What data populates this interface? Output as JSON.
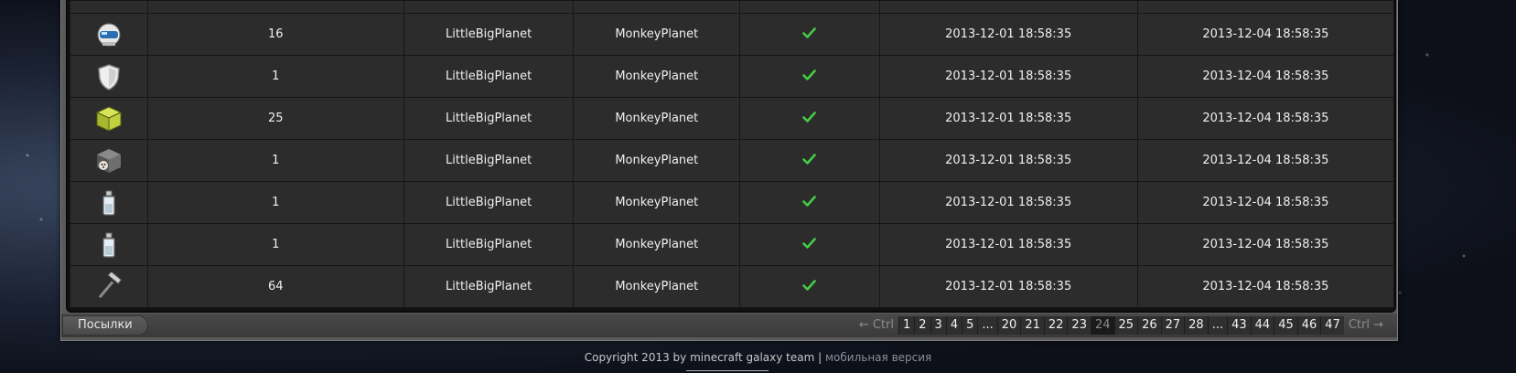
{
  "table": {
    "rows": [
      {
        "icon": "robot-helmet-icon",
        "count": "16",
        "server": "LittleBigPlanet",
        "owner": "MonkeyPlanet",
        "status": "check-icon",
        "created": "2013-12-01 18:58:35",
        "expires": "2013-12-04 18:58:35"
      },
      {
        "icon": "shield-icon",
        "count": "1",
        "server": "LittleBigPlanet",
        "owner": "MonkeyPlanet",
        "status": "check-icon",
        "created": "2013-12-01 18:58:35",
        "expires": "2013-12-04 18:58:35"
      },
      {
        "icon": "green-cube-icon",
        "count": "25",
        "server": "LittleBigPlanet",
        "owner": "MonkeyPlanet",
        "status": "check-icon",
        "created": "2013-12-01 18:58:35",
        "expires": "2013-12-04 18:58:35"
      },
      {
        "icon": "raccoon-block-icon",
        "count": "1",
        "server": "LittleBigPlanet",
        "owner": "MonkeyPlanet",
        "status": "check-icon",
        "created": "2013-12-01 18:58:35",
        "expires": "2013-12-04 18:58:35"
      },
      {
        "icon": "glass-bottle-icon",
        "count": "1",
        "server": "LittleBigPlanet",
        "owner": "MonkeyPlanet",
        "status": "check-icon",
        "created": "2013-12-01 18:58:35",
        "expires": "2013-12-04 18:58:35"
      },
      {
        "icon": "glass-bottle-icon",
        "count": "1",
        "server": "LittleBigPlanet",
        "owner": "MonkeyPlanet",
        "status": "check-icon",
        "created": "2013-12-01 18:58:35",
        "expires": "2013-12-04 18:58:35"
      },
      {
        "icon": "hammer-tool-icon",
        "count": "64",
        "server": "LittleBigPlanet",
        "owner": "MonkeyPlanet",
        "status": "check-icon",
        "created": "2013-12-01 18:58:35",
        "expires": "2013-12-04 18:58:35"
      }
    ]
  },
  "bottombar": {
    "tab_label": "Посылки",
    "prev_label": "← Ctrl",
    "next_label": "Ctrl →",
    "pages": [
      "1",
      "2",
      "3",
      "4",
      "5",
      "...",
      "20",
      "21",
      "22",
      "23",
      "24",
      "25",
      "26",
      "27",
      "28",
      "...",
      "43",
      "44",
      "45",
      "46",
      "47"
    ],
    "current_page": "24"
  },
  "footer": {
    "copyright": "Copyright 2013 by minecraft galaxy team |",
    "mobile_link": "мобильная версия"
  },
  "colors": {
    "check": "#44cc44",
    "row_bg": "#2c2c2c",
    "page_bg": "#131824"
  }
}
